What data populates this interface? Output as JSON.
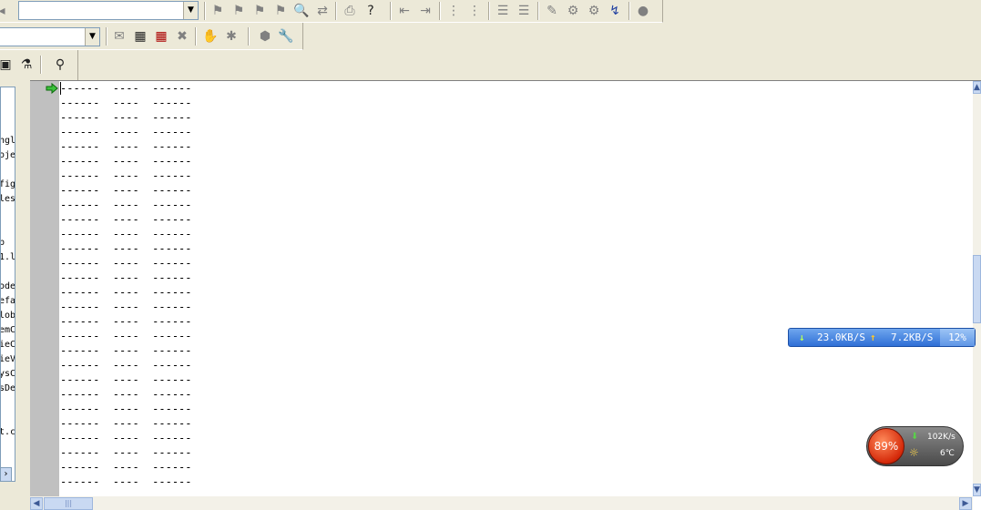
{
  "toolbar1": {
    "combo_value": "",
    "icons": [
      "toggle-bookmark-icon",
      "next-bookmark-icon",
      "prev-bookmark-icon",
      "clear-bookmarks-icon",
      "find-icon",
      "replace-icon",
      "print-icon",
      "context-help-icon",
      "outdent-icon",
      "indent-icon",
      "comment-icon",
      "uncomment-icon",
      "align-left-icon",
      "align-right-icon",
      "compile-icon",
      "build-icon",
      "stop-build-icon",
      "go-icon",
      "breakpoint-icon"
    ]
  },
  "toolbar2": {
    "combo_value": "",
    "icons": [
      "class-wizard-icon",
      "resource-view-icon",
      "dialog-editor-icon",
      "remove-icon",
      "hand-icon",
      "go-icon",
      "settings-icon",
      "wrench-icon"
    ]
  },
  "toolbar3": {
    "icons": [
      "monitor-icon",
      "debug-icon",
      "search-icon"
    ]
  },
  "left_pane": {
    "items": [
      {
        "label": "ngl"
      },
      {
        "label": "oje"
      },
      {
        "label": "fig"
      },
      {
        "label": "les"
      },
      {
        "label": "b"
      },
      {
        "label": "1.l"
      },
      {
        "label": "ode"
      },
      {
        "label": "efa"
      },
      {
        "label": "lob"
      },
      {
        "label": "emC"
      },
      {
        "label": "ieC"
      },
      {
        "label": "ieV"
      },
      {
        "label": "ysC"
      },
      {
        "label": "sDe"
      },
      {
        "label": "t.c"
      }
    ],
    "scroll_arrow": "›"
  },
  "editor": {
    "lines": [
      "------  ----  ------",
      "------  ----  ------",
      "------  ----  ------",
      "------  ----  ------",
      "------  ----  ------",
      "------  ----  ------",
      "------  ----  ------",
      "------  ----  ------",
      "------  ----  ------",
      "------  ----  ------",
      "------  ----  ------",
      "------  ----  ------",
      "------  ----  ------",
      "------  ----  ------",
      "------  ----  ------",
      "------  ----  ------",
      "------  ----  ------",
      "------  ----  ------",
      "------  ----  ------",
      "------  ----  ------",
      "------  ----  ------",
      "------  ----  ------",
      "------  ----  ------",
      "------  ----  ------",
      "------  ----  ------",
      "------  ----  ------",
      "------  ----  ------",
      "------  ----  ------",
      "------  ----  ------"
    ],
    "hscroll_thumb": "|||"
  },
  "net_widget": {
    "down_arrow": "↓",
    "down_speed": "23.0KB/S",
    "up_arrow": "↑",
    "up_speed": "7.2KB/S",
    "percent": "12%"
  },
  "monitor_widget": {
    "percent": "89%",
    "speed": "102K/s",
    "temperature": "6℃"
  },
  "colors": {
    "toolbar_bg": "#ece9d8",
    "gutter": "#c0c0c0",
    "accent_blue": "#2f6fd6",
    "monitor_red": "#d52a0a"
  }
}
